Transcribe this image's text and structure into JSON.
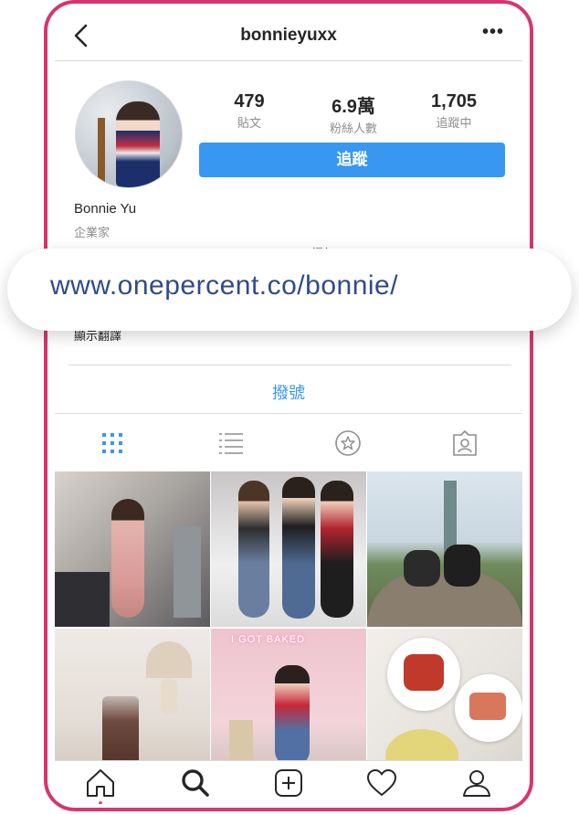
{
  "header": {
    "username": "bonnieyuxx",
    "more_label": "•••"
  },
  "profile": {
    "stats": [
      {
        "value": "479",
        "label": "貼文"
      },
      {
        "value": "6.9萬",
        "label": "粉絲人數"
      },
      {
        "value": "1,705",
        "label": "追蹤中"
      }
    ],
    "follow_label": "追蹤",
    "name": "Bonnie Yu",
    "category": "企業家",
    "bio_line": "Creative Director@AMAZE/ Founder@Match網紅104/ONE PERCENT",
    "bio_line2": "顯示翻譯"
  },
  "banner": {
    "url": "www.onepercent.co/bonnie/"
  },
  "actions": {
    "call_label": "撥號"
  },
  "colors": {
    "accent": "#3897f0",
    "frame": "#d6366f",
    "link": "#2f4c86"
  }
}
